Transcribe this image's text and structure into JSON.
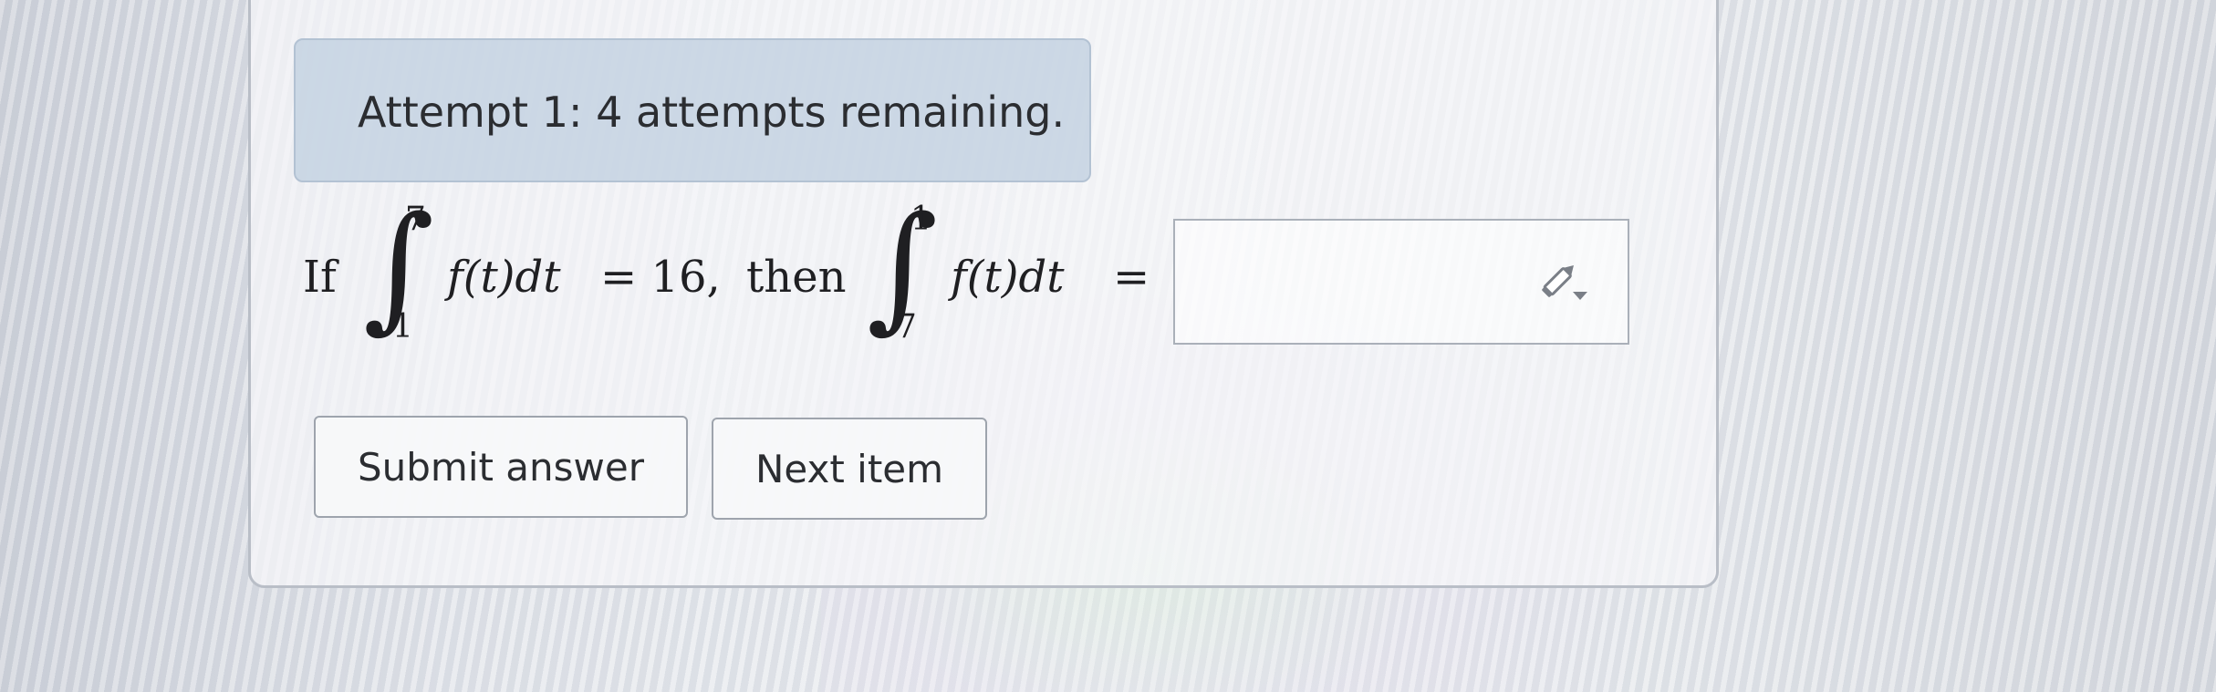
{
  "attempt": {
    "text": "Attempt 1: 4 attempts remaining."
  },
  "question": {
    "prefix": "If",
    "integral1": {
      "lower": "1",
      "upper": "7",
      "integrand": "f(t)dt",
      "equals": "= 16,"
    },
    "connector": "then",
    "integral2": {
      "lower": "7",
      "upper": "1",
      "integrand": "f(t)dt",
      "equals": "="
    }
  },
  "answer": {
    "value": "",
    "icon": "pencil-dropdown-icon"
  },
  "buttons": {
    "submit_label": "Submit answer",
    "next_label": "Next item"
  },
  "colors": {
    "banner_bg": "#c4d2e2",
    "card_border": "#b9bec7",
    "text": "#2b2d31"
  }
}
